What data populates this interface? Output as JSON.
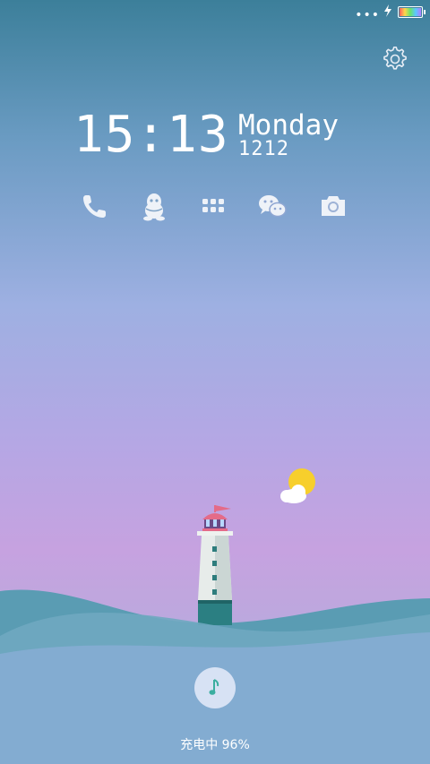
{
  "status_bar": {
    "dots_icon": "more-dots-icon",
    "charging_icon": "lightning-bolt-icon",
    "battery_icon": "battery-rainbow-icon"
  },
  "clock": {
    "time": "15:13",
    "day": "Monday",
    "date": "1212"
  },
  "settings_icon": "gear-icon",
  "shortcuts": [
    {
      "name": "phone",
      "icon": "phone-icon"
    },
    {
      "name": "qq",
      "icon": "qq-penguin-icon"
    },
    {
      "name": "apps",
      "icon": "grid-dots-icon"
    },
    {
      "name": "wechat",
      "icon": "wechat-icon"
    },
    {
      "name": "camera",
      "icon": "camera-icon"
    }
  ],
  "music_button_icon": "music-note-icon",
  "charging_text": "充电中 96%",
  "colors": {
    "sky_top": "#3c7f9a",
    "sky_mid": "#9eb0e2",
    "sky_low": "#c6a2e0",
    "sea": "#5f9bb0",
    "accent_music": "#3aaea0"
  }
}
